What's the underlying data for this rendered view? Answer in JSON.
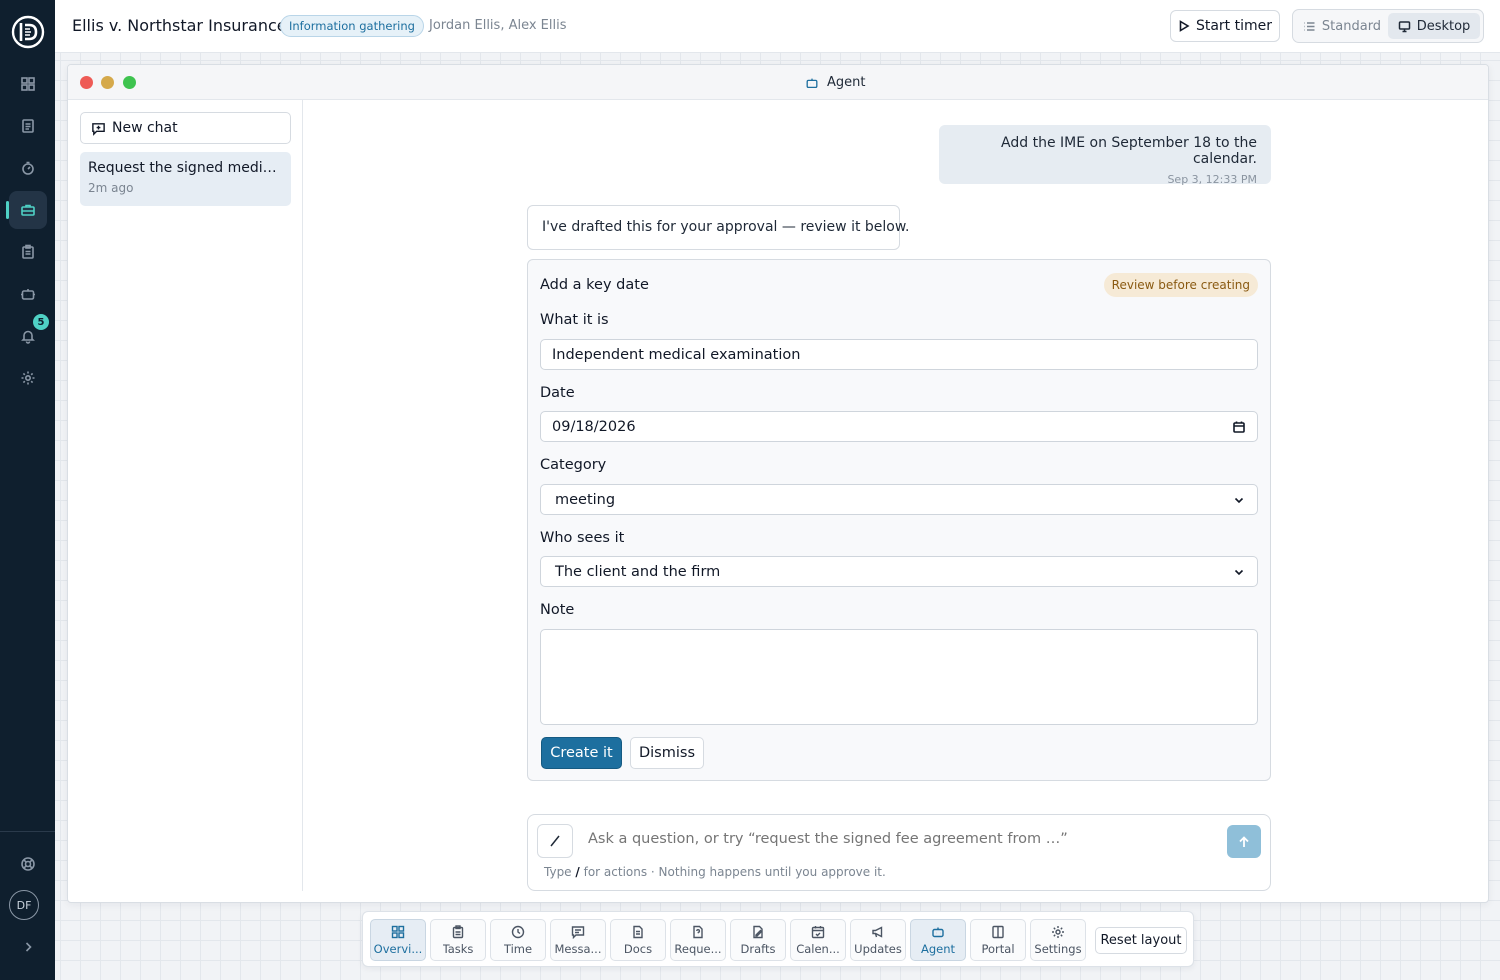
{
  "rail": {
    "items": [
      {
        "icon": "dashboard-icon"
      },
      {
        "icon": "document-icon"
      },
      {
        "icon": "stopwatch-icon"
      },
      {
        "icon": "briefcase-icon",
        "active": true
      },
      {
        "icon": "clipboard-icon"
      },
      {
        "icon": "robot-icon"
      },
      {
        "icon": "bell-icon"
      },
      {
        "icon": "gear-icon"
      }
    ],
    "notification_count": "5",
    "avatar_initials": "DF"
  },
  "header": {
    "case_title": "Ellis v. Northstar Insurance",
    "stage_badge": "Information gathering",
    "clients": "Jordan Ellis, Alex Ellis",
    "start_timer_label": "Start timer",
    "view_options": [
      "Standard",
      "Desktop"
    ],
    "active_view": "Desktop"
  },
  "window": {
    "title": "Agent"
  },
  "chat_list": {
    "new_chat_label": "New chat",
    "items": [
      {
        "title": "Request the signed medica...",
        "time": "2m ago"
      }
    ]
  },
  "conversation": {
    "user_message": {
      "text": "Add the IME on September 18 to the calendar.",
      "time": "Sep 3, 12:33 PM"
    },
    "agent_message": "I've drafted this for your approval — review it below."
  },
  "card": {
    "title": "Add a key date",
    "badge": "Review before creating",
    "what_label": "What it is",
    "what_value": "Independent medical examination",
    "date_label": "Date",
    "date_value": "09/18/2026",
    "category_label": "Category",
    "category_value": "meeting",
    "visibility_label": "Who sees it",
    "visibility_value": "The client and the firm",
    "note_label": "Note",
    "note_value": "",
    "create_label": "Create it",
    "dismiss_label": "Dismiss"
  },
  "composer": {
    "placeholder": "Ask a question, or try “request the signed fee agreement from …”",
    "hint_prefix": "Type",
    "hint_key": "/",
    "hint_suffix": "for actions · Nothing happens until you approve it."
  },
  "dock": {
    "items": [
      {
        "label": "Overvi...",
        "icon": "overview-icon",
        "active": true
      },
      {
        "label": "Tasks",
        "icon": "clipboard-icon"
      },
      {
        "label": "Time",
        "icon": "clock-icon"
      },
      {
        "label": "Messa...",
        "icon": "message-icon"
      },
      {
        "label": "Docs",
        "icon": "document-icon"
      },
      {
        "label": "Reque...",
        "icon": "request-icon"
      },
      {
        "label": "Drafts",
        "icon": "draft-icon"
      },
      {
        "label": "Calen...",
        "icon": "calendar-icon"
      },
      {
        "label": "Updates",
        "icon": "megaphone-icon"
      },
      {
        "label": "Agent",
        "icon": "robot-icon",
        "active": true
      },
      {
        "label": "Portal",
        "icon": "portal-icon"
      },
      {
        "label": "Settings",
        "icon": "gear-icon"
      }
    ],
    "reset_label": "Reset layout"
  },
  "colors": {
    "rail": "#0f1f2e",
    "accent_teal": "#4fd1c5",
    "primary_blue": "#1d6f9f"
  }
}
